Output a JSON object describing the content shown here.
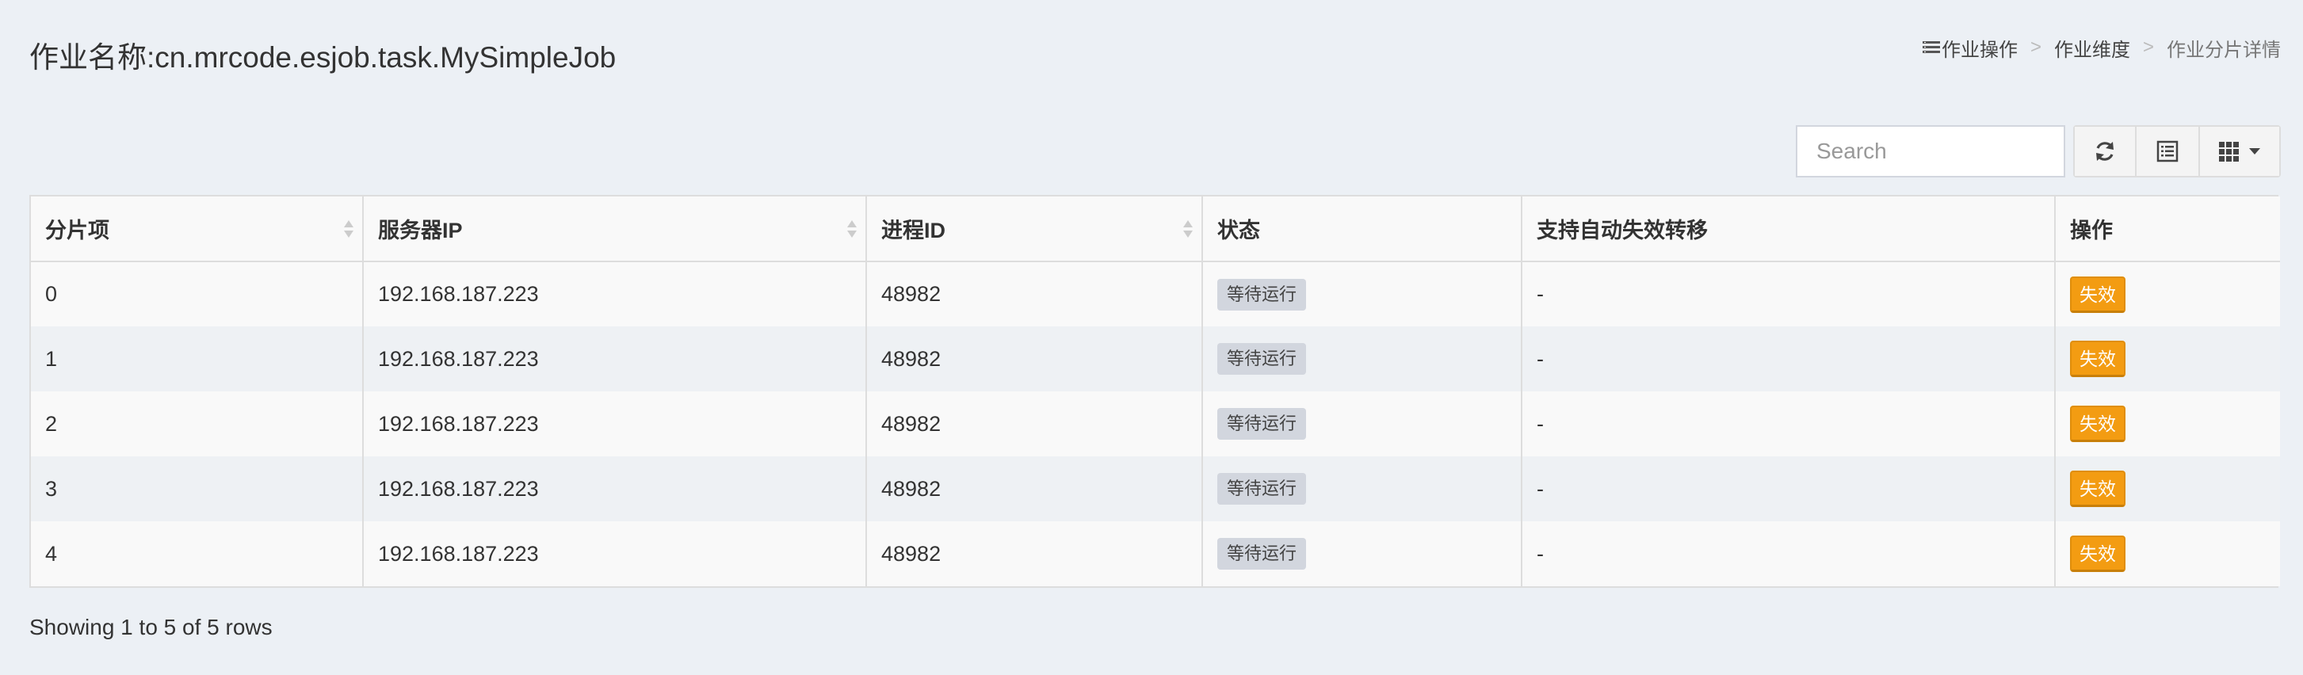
{
  "header": {
    "title": "作业名称:cn.mrcode.esjob.task.MySimpleJob"
  },
  "breadcrumb": {
    "items": [
      "作业操作",
      "作业维度",
      "作业分片详情"
    ],
    "separator": ">"
  },
  "toolbar": {
    "search_placeholder": "Search",
    "refresh_icon": "refresh-icon",
    "toggle_icon": "list-view-icon",
    "columns_icon": "columns-grid-icon"
  },
  "table": {
    "columns": [
      "分片项",
      "服务器IP",
      "进程ID",
      "状态",
      "支持自动失效转移",
      "操作"
    ],
    "rows": [
      {
        "item": "0",
        "ip": "192.168.187.223",
        "pid": "48982",
        "status": "等待运行",
        "failover": "-",
        "action": "失效"
      },
      {
        "item": "1",
        "ip": "192.168.187.223",
        "pid": "48982",
        "status": "等待运行",
        "failover": "-",
        "action": "失效"
      },
      {
        "item": "2",
        "ip": "192.168.187.223",
        "pid": "48982",
        "status": "等待运行",
        "failover": "-",
        "action": "失效"
      },
      {
        "item": "3",
        "ip": "192.168.187.223",
        "pid": "48982",
        "status": "等待运行",
        "failover": "-",
        "action": "失效"
      },
      {
        "item": "4",
        "ip": "192.168.187.223",
        "pid": "48982",
        "status": "等待运行",
        "failover": "-",
        "action": "失效"
      }
    ]
  },
  "pagination": {
    "info": "Showing 1 to 5 of 5 rows"
  },
  "colors": {
    "background": "#ecf0f5",
    "warning_button": "#f39c12",
    "status_badge": "#d2d6de"
  }
}
